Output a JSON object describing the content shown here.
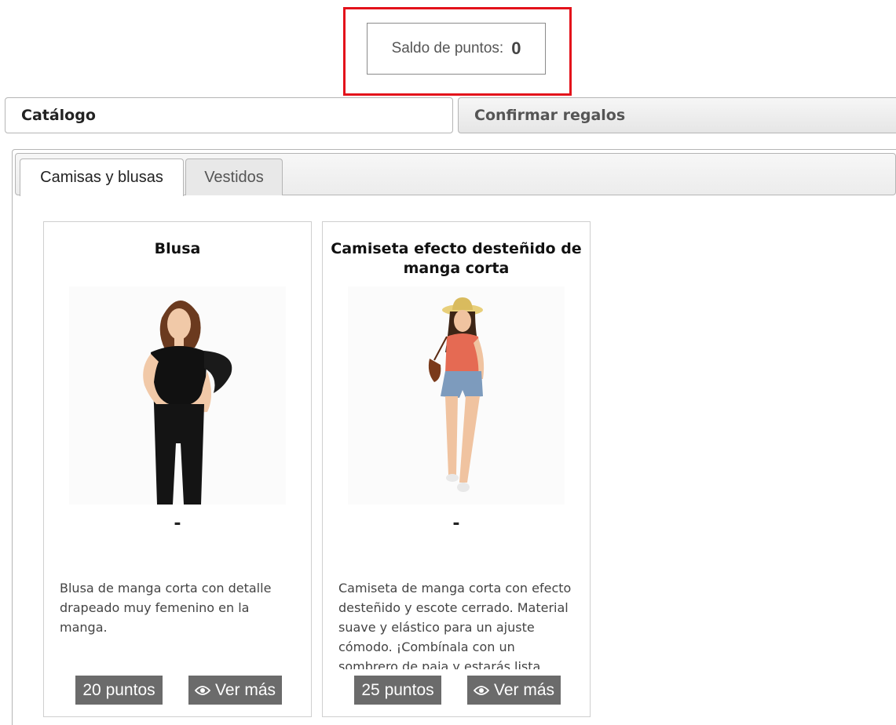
{
  "balance": {
    "label": "Saldo de puntos:",
    "value": "0"
  },
  "sections": {
    "catalog": "Catálogo",
    "confirm": "Confirmar regalos"
  },
  "categories": [
    {
      "label": "Camisas y blusas",
      "active": true
    },
    {
      "label": "Vestidos",
      "active": false
    }
  ],
  "products": [
    {
      "title": "Blusa",
      "dash": "-",
      "description": "Blusa de manga corta con detalle drapeado muy femenino en la manga.",
      "points_label": "20 puntos",
      "more_label": "Ver más"
    },
    {
      "title": "Camiseta efecto desteñido de manga corta",
      "dash": "-",
      "description": "Camiseta de manga corta con efecto desteñido y escote cerrado. Material suave y elástico para un ajuste cómodo. ¡Combínala con un sombrero de paja y estarás lista",
      "points_label": "25 puntos",
      "more_label": "Ver más"
    }
  ],
  "colors": {
    "highlight": "#e3121b",
    "button": "#6b6b6b"
  },
  "icons": {
    "view": "eye-icon"
  }
}
